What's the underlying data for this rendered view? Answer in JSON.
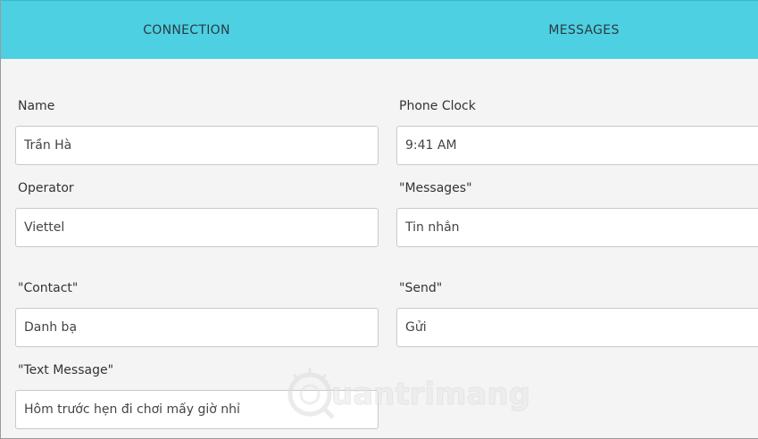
{
  "tabs": [
    {
      "label": "CONNECTION"
    },
    {
      "label": "MESSAGES"
    }
  ],
  "form": {
    "name": {
      "label": "Name",
      "value": "Trần Hà"
    },
    "phone_clock": {
      "label": "Phone Clock",
      "value": "9:41 AM"
    },
    "operator": {
      "label": "Operator",
      "value": "Viettel"
    },
    "messages": {
      "label": "\"Messages\"",
      "value": "Tin nhắn"
    },
    "contact": {
      "label": "\"Contact\"",
      "value": "Danh bạ"
    },
    "send": {
      "label": "\"Send\"",
      "value": "Gửi"
    },
    "text_message": {
      "label": "\"Text Message\"",
      "value": "Hôm trước hẹn đi chơi mấy giờ nhỉ"
    }
  },
  "watermark": {
    "text": "uantrimang"
  },
  "colors": {
    "tabbar": "#4dd0e1",
    "background": "#f4f4f4"
  }
}
